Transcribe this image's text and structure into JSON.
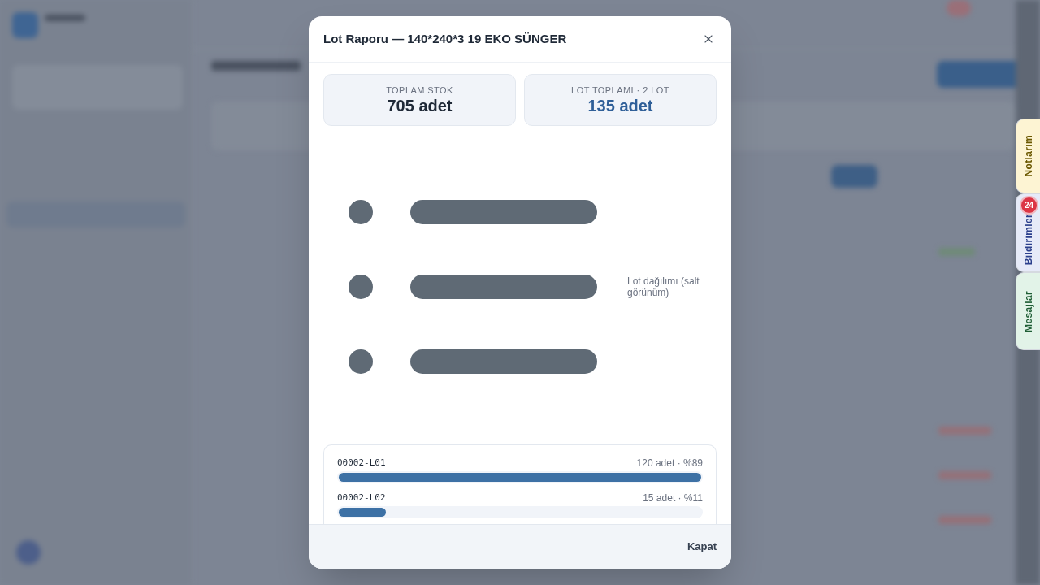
{
  "dialog": {
    "title": "Lot Raporu — 140*240*3 19 EKO SÜNGER",
    "stats": [
      {
        "label": "TOPLAM STOK",
        "value": "705 adet",
        "kind": "plain"
      },
      {
        "label": "LOT TOPLAMI · 2 LOT",
        "value": "135 adet",
        "kind": "accent"
      }
    ],
    "chart_caption": "Lot dağılımı (salt görünüm)",
    "lots": [
      {
        "code": "00002-L01",
        "reading": "120 adet · %89",
        "level": 1
      },
      {
        "code": "00002-L02",
        "reading": "15 adet · %11",
        "level": 0.13
      }
    ],
    "footer_button": "Kapat"
  },
  "side_tabs": [
    {
      "label": "Notlarım",
      "color": "#fdf4d3",
      "kind": "notes"
    },
    {
      "label": "Bildirimler",
      "color": "#e6eaf8",
      "kind": "notifications",
      "badge": "24"
    },
    {
      "label": "Mesajlar",
      "color": "#e2f3e8",
      "kind": "messages"
    }
  ]
}
